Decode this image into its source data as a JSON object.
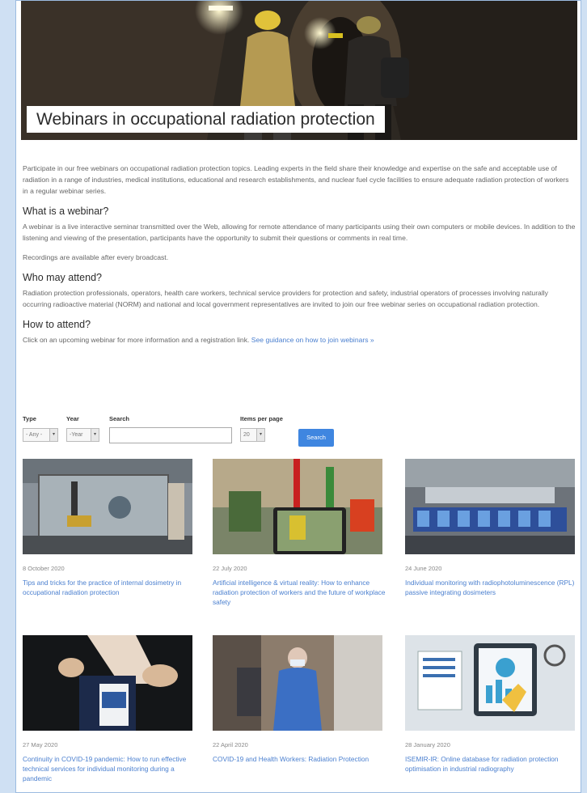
{
  "hero": {
    "title": "Webinars in occupational radiation protection"
  },
  "intro": "Participate in our free webinars on occupational radiation protection topics. Leading experts in the field share their knowledge and expertise on the safe and acceptable use of radiation in a range of industries, medical institutions, educational and research establishments, and nuclear fuel cycle facilities to ensure adequate radiation protection of workers in a regular webinar series.",
  "what": {
    "heading": "What is a webinar?",
    "p1": "A webinar is a live interactive seminar transmitted over the Web, allowing for remote attendance of many participants using their own computers or mobile devices. In addition to the listening and viewing of the presentation, participants have the opportunity to submit their questions or comments in real time.",
    "p2": "Recordings are available after every broadcast."
  },
  "who": {
    "heading": "Who may attend?",
    "p1": "Radiation protection professionals, operators, health care workers, technical service providers for protection and safety, industrial operators of processes involving naturally occurring radioactive material (NORM) and national and local government representatives are invited to join our free webinar series on occupational radiation protection."
  },
  "how": {
    "heading": "How to attend?",
    "text": "Click on an upcoming webinar for more information and a registration link.",
    "link": "See guidance on how to join webinars »"
  },
  "filters": {
    "type_label": "Type",
    "type_value": "- Any -",
    "year_label": "Year",
    "year_value": "-Year",
    "search_label": "Search",
    "items_label": "Items per page",
    "items_value": "20",
    "search_button": "Search"
  },
  "webinars": [
    {
      "date": "8 October 2020",
      "title": "Tips and tricks for the practice of internal dosimetry in occupational radiation protection",
      "image": "lab-robot-image"
    },
    {
      "date": "22 July 2020",
      "title": "Artificial intelligence & virtual reality: How to enhance radiation protection of workers and the future of workplace safety",
      "image": "tablet-plant-image"
    },
    {
      "date": "24 June 2020",
      "title": "Individual monitoring with radiophotoluminescence (RPL) passive integrating dosimeters",
      "image": "dosimeter-rack-image"
    },
    {
      "date": "27 May 2020",
      "title": "Continuity in COVID-19 pandemic: How to run effective technical services for individual monitoring during a pandemic",
      "image": "dosimeter-hands-image"
    },
    {
      "date": "22 April 2020",
      "title": "COVID-19 and Health Workers: Radiation Protection",
      "image": "health-worker-image"
    },
    {
      "date": "28 January 2020",
      "title": "ISEMIR-IR: Online database for radiation protection optimisation in industrial radiography",
      "image": "database-illustration-image"
    }
  ]
}
